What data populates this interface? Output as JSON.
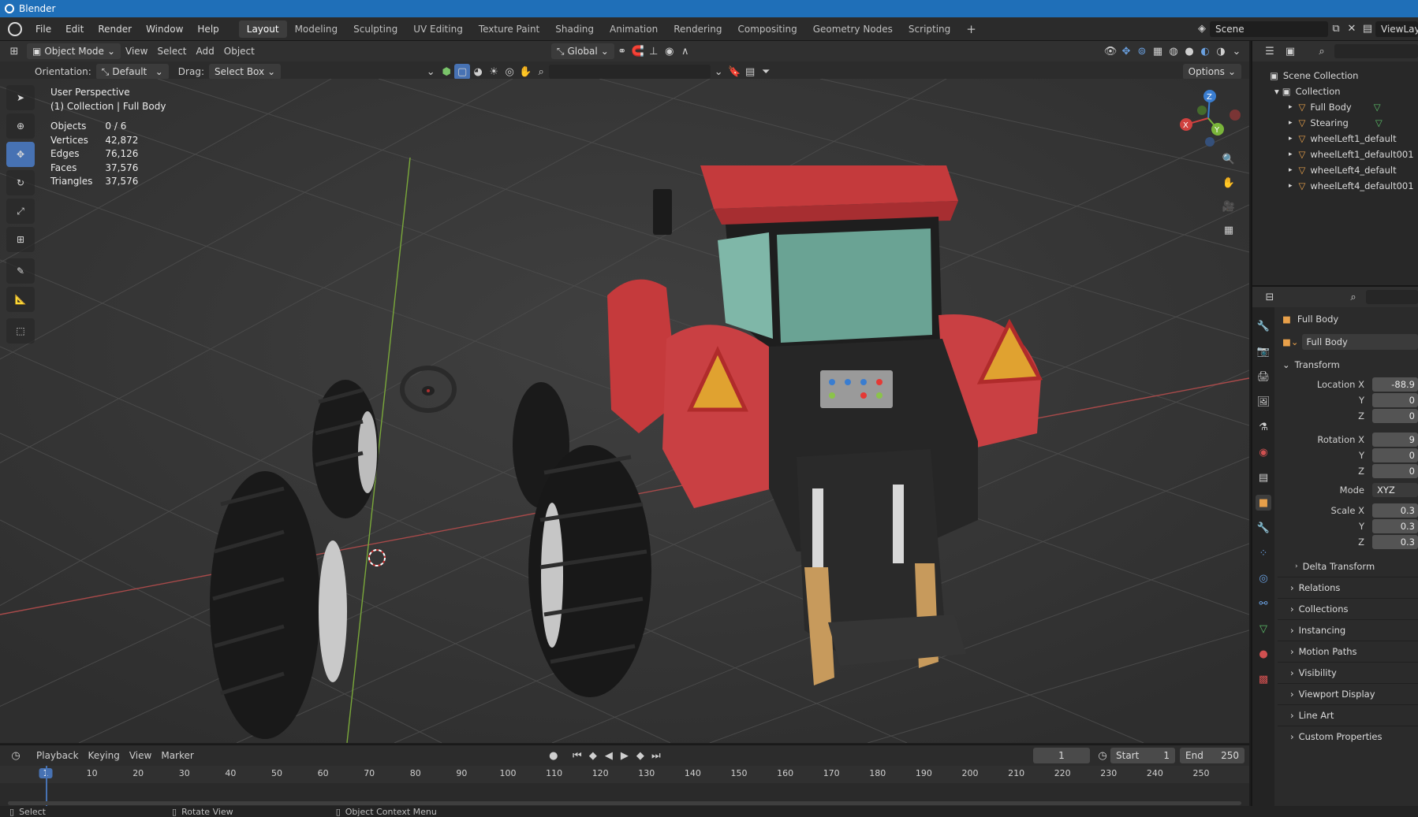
{
  "window": {
    "title": "Blender"
  },
  "menu": [
    "File",
    "Edit",
    "Render",
    "Window",
    "Help"
  ],
  "workspaces": [
    "Layout",
    "Modeling",
    "Sculpting",
    "UV Editing",
    "Texture Paint",
    "Shading",
    "Animation",
    "Rendering",
    "Compositing",
    "Geometry Nodes",
    "Scripting"
  ],
  "active_workspace": "Layout",
  "scene_field": "Scene",
  "viewlayer_field": "ViewLay",
  "viewport_header": {
    "mode": "Object Mode",
    "menus": [
      "View",
      "Select",
      "Add",
      "Object"
    ],
    "transform": "Global",
    "orientation_label": "Orientation:",
    "orientation_value": "Default",
    "drag_label": "Drag:",
    "drag_value": "Select Box",
    "options": "Options"
  },
  "viewport_overlay": {
    "view_name": "User Perspective",
    "collection_line": "(1) Collection | Full Body",
    "stats": [
      {
        "label": "Objects",
        "value": "0 / 6"
      },
      {
        "label": "Vertices",
        "value": "42,872"
      },
      {
        "label": "Edges",
        "value": "76,126"
      },
      {
        "label": "Faces",
        "value": "37,576"
      },
      {
        "label": "Triangles",
        "value": "37,576"
      }
    ]
  },
  "gizmo": {
    "x": "X",
    "y": "Y",
    "z": "Z"
  },
  "outliner": {
    "scene_collection": "Scene Collection",
    "collection": "Collection",
    "items": [
      "Full Body",
      "Stearing",
      "wheelLeft1_default",
      "wheelLeft1_default001",
      "wheelLeft4_default",
      "wheelLeft4_default001"
    ]
  },
  "properties": {
    "object_name": "Full Body",
    "data_name": "Full Body",
    "transform_label": "Transform",
    "location": {
      "label": "Location X",
      "x": "-88.9",
      "y": "0",
      "z": "0"
    },
    "rotation": {
      "label": "Rotation X",
      "x": "9",
      "y": "0",
      "z": "0"
    },
    "mode": {
      "label": "Mode",
      "value": "XYZ Euler"
    },
    "scale": {
      "label": "Scale X",
      "x": "0.3",
      "y": "0.3",
      "z": "0.3"
    },
    "axis_y": "Y",
    "axis_z": "Z",
    "delta": "Delta Transform",
    "panels": [
      "Relations",
      "Collections",
      "Instancing",
      "Motion Paths",
      "Visibility",
      "Viewport Display",
      "Line Art",
      "Custom Properties"
    ]
  },
  "timeline": {
    "menus": [
      "Playback",
      "Keying",
      "View",
      "Marker"
    ],
    "current_frame": "1",
    "start_label": "Start",
    "start": "1",
    "end_label": "End",
    "end": "250",
    "ticks": [
      "1",
      "10",
      "20",
      "30",
      "40",
      "50",
      "60",
      "70",
      "80",
      "90",
      "100",
      "110",
      "120",
      "130",
      "140",
      "150",
      "160",
      "170",
      "180",
      "190",
      "200",
      "210",
      "220",
      "230",
      "240",
      "250"
    ]
  },
  "statusbar": [
    "Select",
    "Rotate View",
    "Object Context Menu"
  ]
}
